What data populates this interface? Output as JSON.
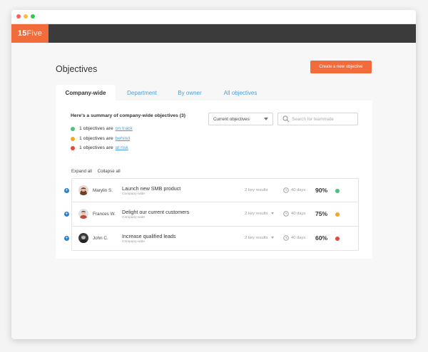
{
  "brand": {
    "logo_num": "15",
    "logo_text": "Five",
    "accent": "#f26b3a"
  },
  "page": {
    "title": "Objectives",
    "create_label": "Create a new objective"
  },
  "tabs": [
    {
      "label": "Company-wide",
      "active": true
    },
    {
      "label": "Department",
      "active": false
    },
    {
      "label": "By owner",
      "active": false
    },
    {
      "label": "All objectives",
      "active": false
    }
  ],
  "summary": {
    "title": "Here's a summary of company-wide objectives (3)",
    "lines": [
      {
        "prefix": "1 objectives are",
        "link": "on track",
        "color": "#4cc17a"
      },
      {
        "prefix": "1 objectives are",
        "link": "behind",
        "color": "#f5a623"
      },
      {
        "prefix": "1 objectives are",
        "link": "at risk",
        "color": "#e8453c"
      }
    ]
  },
  "filter": {
    "selected": "Current objectives"
  },
  "search": {
    "placeholder": "Search for teammate"
  },
  "controls": {
    "expand": "Expand all",
    "collapse": "Collapse all"
  },
  "objectives": [
    {
      "owner": "Marylin S.",
      "title": "Launch new SMB product",
      "scope": "Company-wide",
      "key_results": "2 key results",
      "days": "40 days",
      "progress": "90%",
      "status_color": "#4cc17a",
      "avatar_icon": "avatar-woman-icon"
    },
    {
      "owner": "Frances W.",
      "title": "Delight our current customers",
      "scope": "Company-wide",
      "key_results": "2 key results",
      "days": "40 days",
      "progress": "75%",
      "status_color": "#f5a623",
      "avatar_icon": "avatar-man-icon"
    },
    {
      "owner": "John C.",
      "title": "Increase qualified leads",
      "scope": "Company-wide",
      "key_results": "2 key results",
      "days": "40 days",
      "progress": "60%",
      "status_color": "#e8453c",
      "avatar_icon": "avatar-man-dark-icon"
    }
  ]
}
